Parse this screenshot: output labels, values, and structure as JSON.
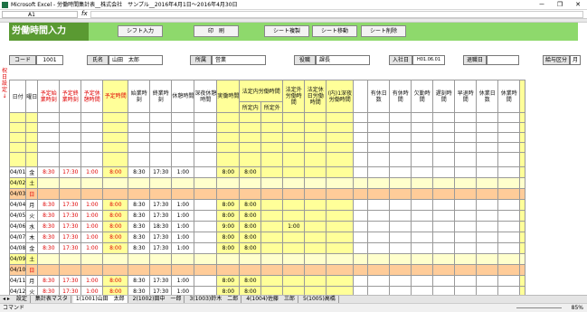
{
  "window": {
    "title": "Microsoft Excel - 労働時間集計表__株式会社　サンプル__2016年4月1日～2016年4月30日",
    "min": "－",
    "max": "❐",
    "close": "✕"
  },
  "formula": {
    "cell": "A1",
    "fx": "fx"
  },
  "banner": {
    "title": "労働時間入力",
    "buttons": [
      "シフト入力",
      "印　刷",
      "シート複製",
      "シート移動",
      "シート削除"
    ]
  },
  "info": {
    "code_label": "コード",
    "code_value": "1001",
    "name_label": "氏名",
    "name_value": "山田　太郎",
    "dept_label": "所属",
    "dept_value": "営業",
    "role_label": "役職",
    "role_value": "課長",
    "join_label": "入社日",
    "join_value": "H01.06.01",
    "leave_label": "退職日",
    "leave_value": "",
    "pay_label": "給与区分",
    "pay_value": "月"
  },
  "side_note": "祝日設定↓",
  "headers": {
    "day": "日付",
    "dow": "曜日",
    "plan_start": "予定始業時刻",
    "plan_end": "予定終業時刻",
    "plan_break": "予定休憩時間",
    "plan_hours": "予定時間",
    "start": "始業時刻",
    "end": "終業時刻",
    "break": "休憩時間",
    "late_break": "深夜休憩時間",
    "actual": "実働時間",
    "legal_group": "法定内労働時間",
    "legal_in": "所定内",
    "legal_out": "所定外",
    "over": "法定外労働時間",
    "holiday": "法定休日労働時間",
    "shift": "(内)1深夜労働時間",
    "paid_days": "有休日数",
    "paid_hours": "有休時間",
    "absent": "欠勤時間",
    "late": "遅刻時間",
    "early": "早退時間",
    "comp": "休業日数",
    "comp2": "休業時間"
  },
  "rows": [
    {
      "date": "04/01",
      "dow": "金",
      "ps": "8:30",
      "pe": "17:30",
      "pb": "1:00",
      "ph": "8:00",
      "s": "8:30",
      "e": "17:30",
      "b": "1:00",
      "a": "8:00",
      "li": "8:00",
      "lo": "",
      "ov": "",
      "type": "weekday"
    },
    {
      "date": "04/02",
      "dow": "土",
      "type": "sat"
    },
    {
      "date": "04/03",
      "dow": "日",
      "type": "sun"
    },
    {
      "date": "04/04",
      "dow": "月",
      "ps": "8:30",
      "pe": "17:30",
      "pb": "1:00",
      "ph": "8:00",
      "s": "8:30",
      "e": "17:30",
      "b": "1:00",
      "a": "8:00",
      "li": "8:00",
      "lo": "",
      "ov": "",
      "type": "weekday"
    },
    {
      "date": "04/05",
      "dow": "火",
      "ps": "8:30",
      "pe": "17:30",
      "pb": "1:00",
      "ph": "8:00",
      "s": "8:30",
      "e": "17:30",
      "b": "1:00",
      "a": "8:00",
      "li": "8:00",
      "lo": "",
      "ov": "",
      "type": "weekday"
    },
    {
      "date": "04/06",
      "dow": "水",
      "ps": "8:30",
      "pe": "17:30",
      "pb": "1:00",
      "ph": "8:00",
      "s": "8:30",
      "e": "18:30",
      "b": "1:00",
      "a": "9:00",
      "li": "8:00",
      "lo": "",
      "ov": "1:00",
      "type": "weekday"
    },
    {
      "date": "04/07",
      "dow": "木",
      "ps": "8:30",
      "pe": "17:30",
      "pb": "1:00",
      "ph": "8:00",
      "s": "8:30",
      "e": "17:30",
      "b": "1:00",
      "a": "8:00",
      "li": "8:00",
      "lo": "",
      "ov": "",
      "type": "weekday"
    },
    {
      "date": "04/08",
      "dow": "金",
      "ps": "8:30",
      "pe": "17:30",
      "pb": "1:00",
      "ph": "8:00",
      "s": "8:30",
      "e": "17:30",
      "b": "1:00",
      "a": "8:00",
      "li": "8:00",
      "lo": "",
      "ov": "",
      "type": "weekday"
    },
    {
      "date": "04/09",
      "dow": "土",
      "type": "sat"
    },
    {
      "date": "04/10",
      "dow": "日",
      "type": "sun"
    },
    {
      "date": "04/11",
      "dow": "月",
      "ps": "8:30",
      "pe": "17:30",
      "pb": "1:00",
      "ph": "8:00",
      "s": "8:30",
      "e": "17:30",
      "b": "1:00",
      "a": "8:00",
      "li": "8:00",
      "lo": "",
      "ov": "",
      "type": "weekday"
    },
    {
      "date": "04/12",
      "dow": "火",
      "ps": "8:30",
      "pe": "17:30",
      "pb": "1:00",
      "ph": "8:00",
      "s": "8:30",
      "e": "17:30",
      "b": "1:00",
      "a": "8:00",
      "li": "8:00",
      "lo": "",
      "ov": "",
      "type": "weekday"
    }
  ],
  "sheet_tabs": [
    "設定",
    "集計表マスタ",
    "1(1001)山田　太郎",
    "2(1002)田中　一郎",
    "3(1003)鈴木　二郎",
    "4(1004)佐藤　三郎",
    "5(1005)高橋"
  ],
  "status": {
    "mode": "コマンド",
    "zoom": "85%"
  }
}
